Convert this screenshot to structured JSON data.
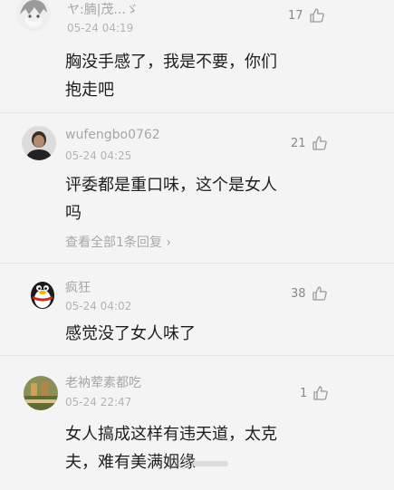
{
  "comments": [
    {
      "username": "ヤ:腩|茂...ゞ",
      "time": "05-24 04:19",
      "likes": "17",
      "lines": [
        "胸没手感了，我是不要，你们",
        "抱走吧"
      ]
    },
    {
      "username": "wufengbo0762",
      "time": "05-24 04:25",
      "likes": "21",
      "lines": [
        "评委都是重口味，这个是女人",
        "吗"
      ],
      "reply_link": "查看全部1条回复 ›"
    },
    {
      "username": "疯狂",
      "time": "05-24 04:02",
      "likes": "38",
      "lines": [
        "感觉没了女人味了"
      ]
    },
    {
      "username": "老衲荤素都吃",
      "time": "05-24 22:47",
      "likes": "1",
      "lines": [
        "女人搞成这样有违天道，太克",
        "夫，难有美满姻缘"
      ]
    }
  ],
  "colors": {
    "background": "#f4f4f4",
    "meta_text": "#a6a6a6",
    "content_text": "#1e1e1e"
  }
}
